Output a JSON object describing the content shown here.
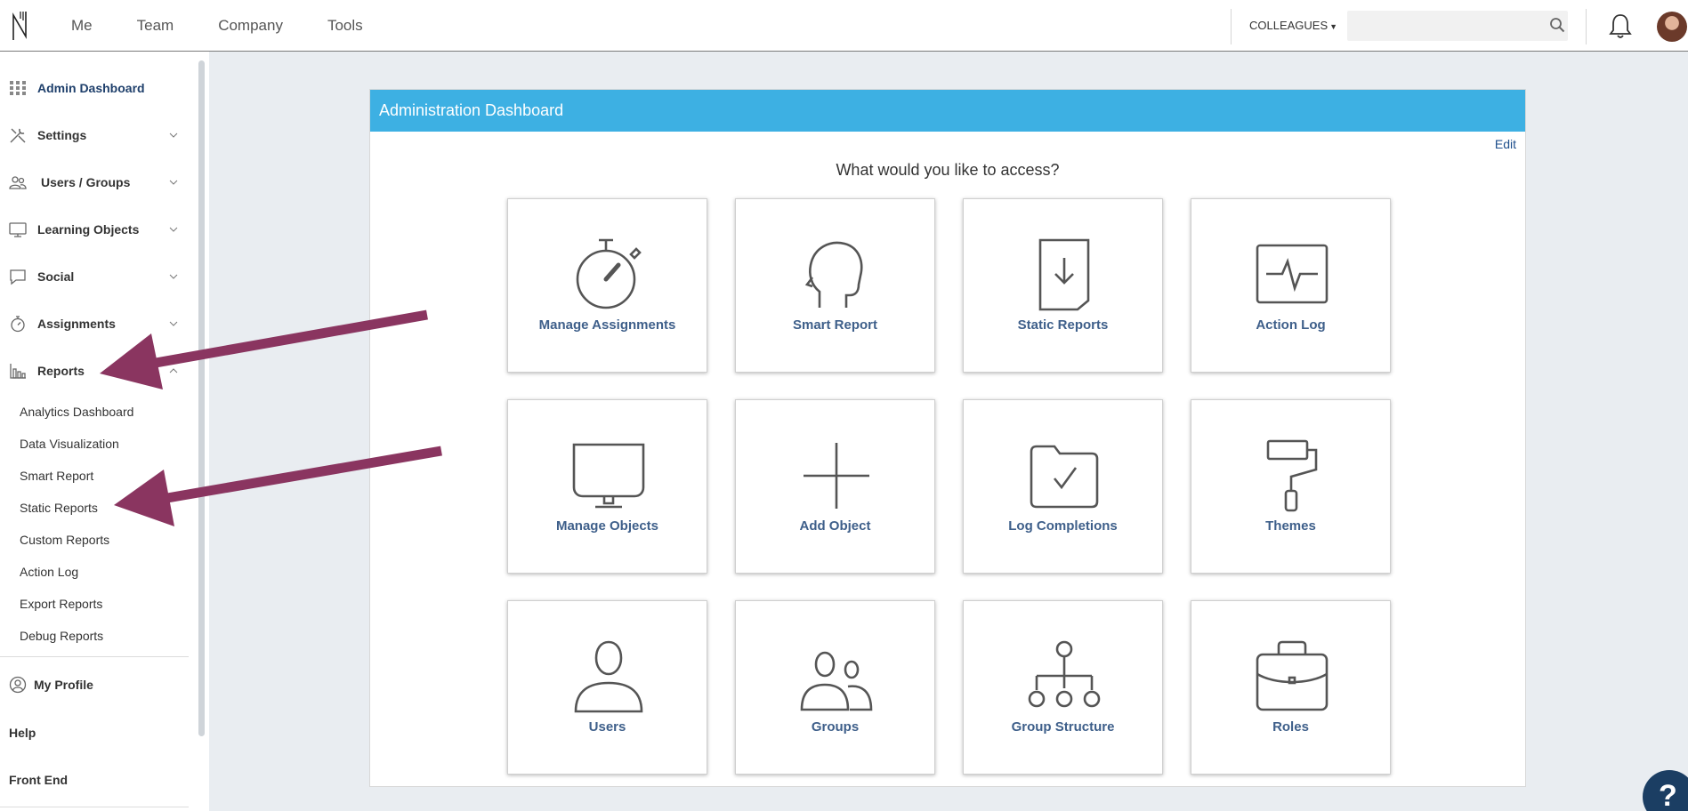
{
  "topnav": {
    "items": [
      "Me",
      "Team",
      "Company",
      "Tools"
    ],
    "colleagues_label": "COLLEAGUES",
    "search_placeholder": ""
  },
  "sidebar": {
    "main_items": [
      {
        "label": "Admin Dashboard",
        "icon": "grid-icon",
        "active": true
      },
      {
        "label": "Settings",
        "icon": "tools-icon",
        "expandable": true
      },
      {
        "label": "Users / Groups",
        "icon": "users-icon",
        "expandable": true
      },
      {
        "label": "Learning Objects",
        "icon": "monitor-icon",
        "expandable": true
      },
      {
        "label": "Social",
        "icon": "chat-bubble-icon",
        "expandable": true
      },
      {
        "label": "Assignments",
        "icon": "stopwatch-icon",
        "expandable": true
      },
      {
        "label": "Reports",
        "icon": "bar-chart-icon",
        "expanded": true
      }
    ],
    "report_items": [
      "Analytics Dashboard",
      "Data Visualization",
      "Smart Report",
      "Static Reports",
      "Custom Reports",
      "Action Log",
      "Export Reports",
      "Debug Reports"
    ],
    "my_profile": "My Profile",
    "help": "Help",
    "front_end": "Front End"
  },
  "panel": {
    "title": "Administration Dashboard",
    "edit_label": "Edit",
    "question": "What would you like to access?",
    "tiles": [
      {
        "label": "Manage Assignments",
        "icon": "stopwatch-icon"
      },
      {
        "label": "Smart Report",
        "icon": "head-icon"
      },
      {
        "label": "Static Reports",
        "icon": "document-download-icon"
      },
      {
        "label": "Action Log",
        "icon": "activity-monitor-icon"
      },
      {
        "label": "Manage Objects",
        "icon": "monitor-icon"
      },
      {
        "label": "Add Object",
        "icon": "plus-icon"
      },
      {
        "label": "Log Completions",
        "icon": "folder-check-icon"
      },
      {
        "label": "Themes",
        "icon": "paint-roller-icon"
      },
      {
        "label": "Users",
        "icon": "user-icon"
      },
      {
        "label": "Groups",
        "icon": "users-icon"
      },
      {
        "label": "Group Structure",
        "icon": "hierarchy-icon"
      },
      {
        "label": "Roles",
        "icon": "briefcase-icon"
      }
    ]
  },
  "colors": {
    "header_blue": "#3db0e3",
    "tile_label": "#3e5f8a",
    "admin_link": "#1e3f6b",
    "arrow": "#8a3560",
    "help_button": "#1b3e63"
  },
  "help_button_label": "?"
}
